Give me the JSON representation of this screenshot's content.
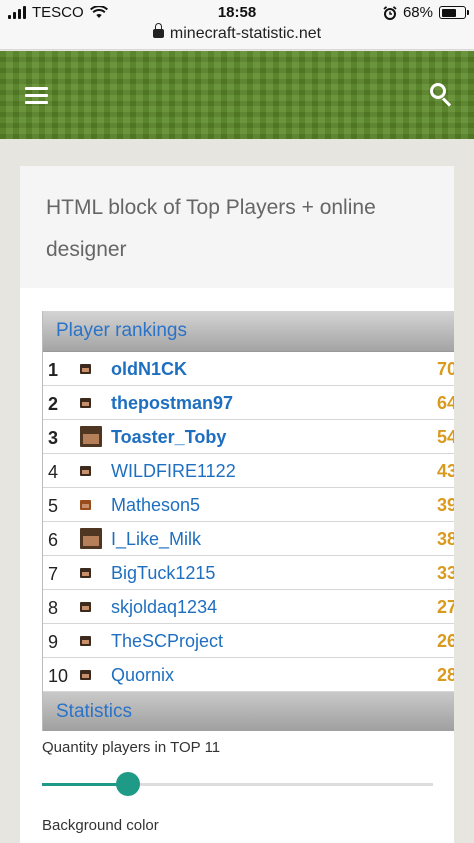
{
  "status_bar": {
    "carrier": "TESCO",
    "time": "18:58",
    "battery": "68%",
    "url": "minecraft-statistic.net"
  },
  "header": {
    "menu_icon": "hamburger-menu-icon",
    "search_icon": "search-icon"
  },
  "card": {
    "title": "HTML block of Top Players + online designer"
  },
  "rankings": {
    "heading": "Player rankings",
    "players": [
      {
        "rank": "1",
        "name": "oldN1CK",
        "score": "70",
        "bold": true,
        "head": "small"
      },
      {
        "rank": "2",
        "name": "thepostman97",
        "score": "64",
        "bold": true,
        "head": "small"
      },
      {
        "rank": "3",
        "name": "Toaster_Toby",
        "score": "54",
        "bold": true,
        "head": "big"
      },
      {
        "rank": "4",
        "name": "WILDFIRE1122",
        "score": "43",
        "bold": false,
        "head": "small"
      },
      {
        "rank": "5",
        "name": "Matheson5",
        "score": "39",
        "bold": false,
        "head": "orange"
      },
      {
        "rank": "6",
        "name": "I_Like_Milk",
        "score": "38",
        "bold": false,
        "head": "big"
      },
      {
        "rank": "7",
        "name": "BigTuck1215",
        "score": "33",
        "bold": false,
        "head": "small"
      },
      {
        "rank": "8",
        "name": "skjoldaq1234",
        "score": "27",
        "bold": false,
        "head": "small"
      },
      {
        "rank": "9",
        "name": "TheSCProject",
        "score": "26",
        "bold": false,
        "head": "small"
      },
      {
        "rank": "10",
        "name": "Quornix",
        "score": "28",
        "bold": false,
        "head": "small"
      }
    ]
  },
  "statistics": {
    "heading": "Statistics"
  },
  "designer": {
    "quantity_label": "Quantity players in TOP 11",
    "quantity_level_fraction": 0.22,
    "background_label": "Background color",
    "accent_color": "#1f9a86"
  }
}
